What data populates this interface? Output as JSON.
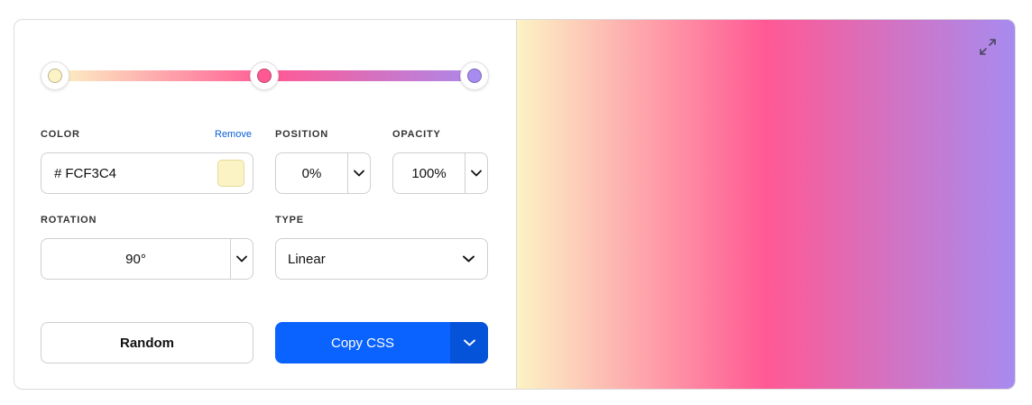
{
  "gradient": {
    "type": "Linear",
    "rotation": "90°",
    "stops": [
      {
        "color": "#FCF3C4",
        "position": 0
      },
      {
        "color": "#FF5994",
        "position": 50
      },
      {
        "color": "#A78BF0",
        "position": 100
      }
    ]
  },
  "editor": {
    "color_label": "COLOR",
    "remove_label": "Remove",
    "hash": "#",
    "color_value": "FCF3C4",
    "swatch_color": "#FCF3C4",
    "position_label": "POSITION",
    "position_value": "0%",
    "opacity_label": "OPACITY",
    "opacity_value": "100%",
    "rotation_label": "ROTATION",
    "rotation_value": "90°",
    "type_label": "TYPE",
    "type_value": "Linear"
  },
  "actions": {
    "random_label": "Random",
    "copy_label": "Copy CSS"
  },
  "icons": {
    "expand": "expand-arrows-icon",
    "caret": "chevron-down-icon"
  },
  "colors": {
    "accent": "#0A63FF",
    "accent_dark": "#0553D8",
    "link": "#0A5FD6"
  }
}
